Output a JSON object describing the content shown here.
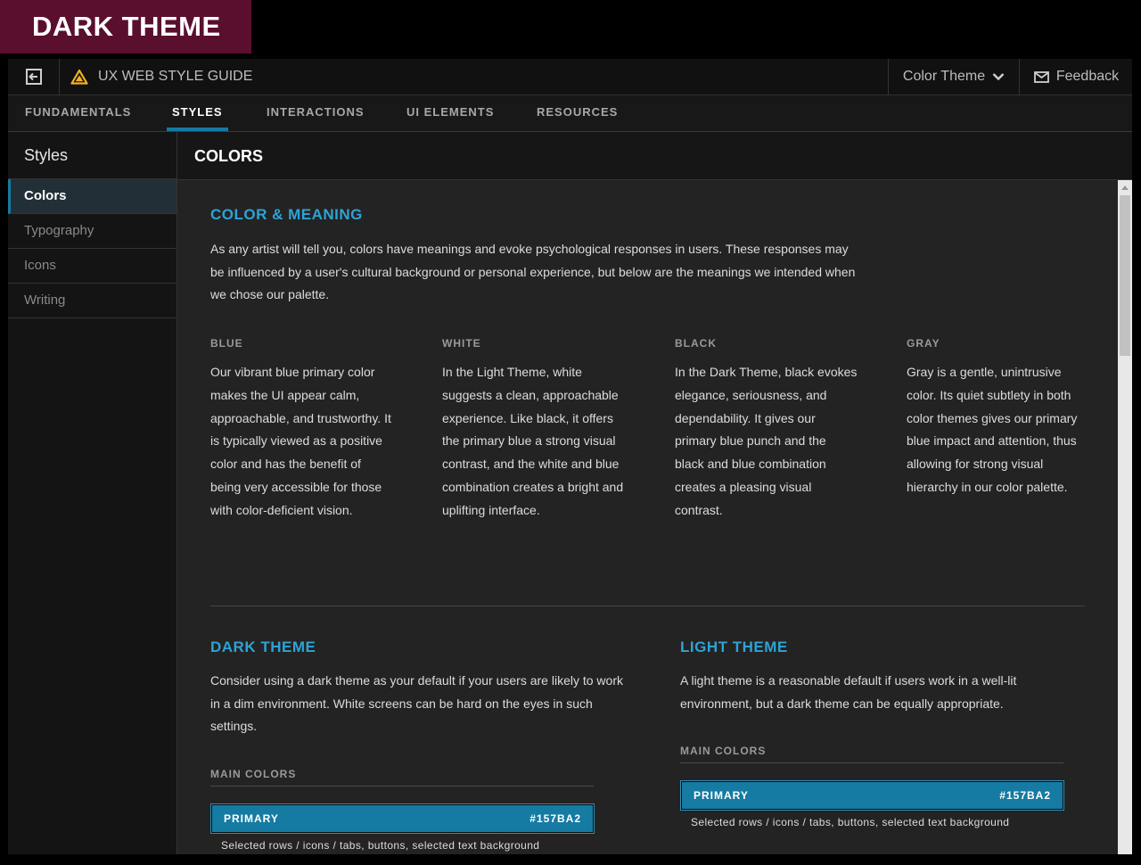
{
  "badge": "DARK THEME",
  "header": {
    "brand": "UX WEB STYLE GUIDE",
    "color_theme": "Color Theme",
    "feedback": "Feedback"
  },
  "nav": {
    "tabs": [
      "FUNDAMENTALS",
      "STYLES",
      "INTERACTIONS",
      "UI ELEMENTS",
      "RESOURCES"
    ],
    "active": "STYLES"
  },
  "sidebar": {
    "title": "Styles",
    "items": [
      "Colors",
      "Typography",
      "Icons",
      "Writing"
    ],
    "active": "Colors"
  },
  "page_title": "COLORS",
  "color_meaning": {
    "heading": "COLOR & MEANING",
    "intro": "As any artist will tell you, colors have meanings and evoke psychological responses in users. These responses may be influenced by a user's cultural background or personal experience, but below are the meanings we intended when we chose our palette.",
    "columns": [
      {
        "title": "BLUE",
        "text": "Our vibrant blue primary color makes the UI appear calm, approachable, and trustworthy. It is typically viewed as a positive color and has the benefit of being very accessible for those with color-deficient vision."
      },
      {
        "title": "WHITE",
        "text": "In the Light Theme, white suggests a clean, approachable experience. Like black, it offers the primary blue a strong visual contrast, and the white and blue combination creates a bright and uplifting interface."
      },
      {
        "title": "BLACK",
        "text": "In the Dark Theme, black evokes elegance, seriousness, and dependability. It gives our primary blue punch and the black and blue combination creates a pleasing visual contrast."
      },
      {
        "title": "GRAY",
        "text": "Gray is a gentle, unintrusive color. Its quiet subtlety in both color themes gives our primary blue impact and attention, thus allowing for strong visual hierarchy in our color palette."
      }
    ]
  },
  "dark_theme": {
    "heading": "DARK THEME",
    "text": "Consider using a dark theme as your default if your users are likely to work in a dim environment. White screens can be hard on the eyes in such settings.",
    "main_colors_label": "MAIN COLORS",
    "swatch": {
      "name": "PRIMARY",
      "hex": "#157BA2",
      "desc": "Selected rows / icons / tabs, buttons, selected text background"
    }
  },
  "light_theme": {
    "heading": "LIGHT THEME",
    "text": "A light theme is a reasonable default if users work in a well-lit environment, but a dark theme can be equally appropriate.",
    "main_colors_label": "MAIN COLORS",
    "swatch": {
      "name": "PRIMARY",
      "hex": "#157BA2",
      "desc": "Selected rows / icons / tabs, buttons, selected text background"
    }
  },
  "colors": {
    "accent": "#157BA2",
    "heading_blue": "#2EA3D5",
    "badge": "#5A0F2E",
    "warning_icon": "#F0B323"
  },
  "icons": [
    "exit-icon",
    "warning-triangle-icon",
    "chevron-down-icon",
    "mail-icon"
  ]
}
